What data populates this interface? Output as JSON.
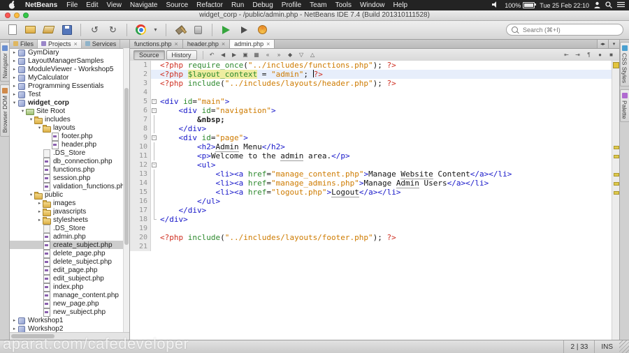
{
  "menubar": {
    "app_name": "NetBeans",
    "items": [
      "File",
      "Edit",
      "View",
      "Navigate",
      "Source",
      "Refactor",
      "Run",
      "Debug",
      "Profile",
      "Team",
      "Tools",
      "Window",
      "Help"
    ],
    "status": {
      "battery_percent": "100%",
      "clock": "Tue 25 Feb 22:10"
    }
  },
  "titlebar": {
    "title": "widget_corp - /public/admin.php - NetBeans IDE 7.4 (Build 201310111528)"
  },
  "toolbar": {
    "icons": [
      "new-file",
      "new-project",
      "open-project",
      "save-all",
      "undo",
      "redo",
      "browser-chrome",
      "browser-dropdown",
      "build-project",
      "clean-build",
      "run-project",
      "debug-project",
      "profile-project"
    ],
    "search_placeholder": "Search (⌘+I)"
  },
  "panel": {
    "tabs": [
      {
        "label": "Files",
        "active": false
      },
      {
        "label": "Projects",
        "active": true,
        "closable": true
      },
      {
        "label": "Services",
        "active": false
      }
    ],
    "side_tabs": [
      "Navigator",
      "Browser DOM"
    ],
    "tree": [
      {
        "l": "GymDiary",
        "d": 0,
        "t": "proj",
        "a": "r"
      },
      {
        "l": "LayoutManagerSamples",
        "d": 0,
        "t": "proj",
        "a": "r"
      },
      {
        "l": "ModuleViewer - Workshop5",
        "d": 0,
        "t": "proj",
        "a": "r"
      },
      {
        "l": "MyCalculator",
        "d": 0,
        "t": "proj",
        "a": "r"
      },
      {
        "l": "Programming Essentials",
        "d": 0,
        "t": "proj",
        "a": "r"
      },
      {
        "l": "Test",
        "d": 0,
        "t": "proj",
        "a": "r"
      },
      {
        "l": "widget_corp",
        "d": 0,
        "t": "proj",
        "a": "d",
        "b": true
      },
      {
        "l": "Site Root",
        "d": 1,
        "t": "root",
        "a": "d"
      },
      {
        "l": "includes",
        "d": 2,
        "t": "folder",
        "a": "d"
      },
      {
        "l": "layouts",
        "d": 3,
        "t": "folder",
        "a": "d"
      },
      {
        "l": "footer.php",
        "d": 4,
        "t": "php"
      },
      {
        "l": "header.php",
        "d": 4,
        "t": "php"
      },
      {
        "l": ".DS_Store",
        "d": 3,
        "t": "file"
      },
      {
        "l": "db_connection.php",
        "d": 3,
        "t": "php"
      },
      {
        "l": "functions.php",
        "d": 3,
        "t": "php"
      },
      {
        "l": "session.php",
        "d": 3,
        "t": "php"
      },
      {
        "l": "validation_functions.php",
        "d": 3,
        "t": "php"
      },
      {
        "l": "public",
        "d": 2,
        "t": "folder",
        "a": "d"
      },
      {
        "l": "images",
        "d": 3,
        "t": "folder",
        "a": "r"
      },
      {
        "l": "javascripts",
        "d": 3,
        "t": "folder",
        "a": "r"
      },
      {
        "l": "stylesheets",
        "d": 3,
        "t": "folder",
        "a": "r"
      },
      {
        "l": ".DS_Store",
        "d": 3,
        "t": "file"
      },
      {
        "l": "admin.php",
        "d": 3,
        "t": "php"
      },
      {
        "l": "create_subject.php",
        "d": 3,
        "t": "php",
        "sel": true
      },
      {
        "l": "delete_page.php",
        "d": 3,
        "t": "php"
      },
      {
        "l": "delete_subject.php",
        "d": 3,
        "t": "php"
      },
      {
        "l": "edit_page.php",
        "d": 3,
        "t": "php"
      },
      {
        "l": "edit_subject.php",
        "d": 3,
        "t": "php"
      },
      {
        "l": "index.php",
        "d": 3,
        "t": "php"
      },
      {
        "l": "manage_content.php",
        "d": 3,
        "t": "php"
      },
      {
        "l": "new_page.php",
        "d": 3,
        "t": "php"
      },
      {
        "l": "new_subject.php",
        "d": 3,
        "t": "php"
      },
      {
        "l": "Workshop1",
        "d": 0,
        "t": "proj",
        "a": "r"
      },
      {
        "l": "Workshop2",
        "d": 0,
        "t": "proj",
        "a": "r"
      }
    ]
  },
  "editor": {
    "tabs": [
      {
        "label": "functions.php",
        "active": false
      },
      {
        "label": "header.php",
        "active": false
      },
      {
        "label": "admin.php",
        "active": true
      }
    ],
    "views": [
      "Source",
      "History"
    ],
    "toolbar_icons_left": [
      {
        "name": "last-edit",
        "glyph": "↶"
      },
      {
        "name": "back",
        "glyph": "◀"
      },
      {
        "name": "forward",
        "glyph": "▶"
      },
      {
        "name": "find-selection",
        "glyph": "▣"
      },
      {
        "name": "highlight-occurrences",
        "glyph": "▦"
      },
      {
        "name": "previous-bookmark",
        "glyph": "«"
      },
      {
        "name": "next-bookmark",
        "glyph": "»"
      },
      {
        "name": "toggle-bookmark",
        "glyph": "◆"
      },
      {
        "name": "next-error",
        "glyph": "▽"
      },
      {
        "name": "previous-error",
        "glyph": "△"
      }
    ],
    "toolbar_icons_right": [
      {
        "name": "shift-left",
        "glyph": "⇤"
      },
      {
        "name": "shift-right",
        "glyph": "⇥"
      },
      {
        "name": "comment",
        "glyph": "¶"
      },
      {
        "name": "start-macro",
        "glyph": "●"
      },
      {
        "name": "stop-macro",
        "glyph": "■"
      }
    ],
    "side_tabs": [
      "CSS Styles",
      "Palette"
    ],
    "current_line": 2,
    "warning_lines": [
      10,
      11,
      13,
      14,
      15
    ],
    "fold": [
      "",
      "",
      "",
      "",
      "box",
      "box",
      "bar",
      "bar",
      "box",
      "bar",
      "bar",
      "box",
      "bar",
      "bar",
      "bar",
      "bar",
      "bar",
      "end",
      "",
      "",
      ""
    ],
    "lines": [
      [
        [
          "pt",
          "<?php "
        ],
        [
          "kw",
          "require_once"
        ],
        [
          "pl",
          "("
        ],
        [
          "st",
          "\"../includes/functions.php\""
        ],
        [
          "pl",
          "); "
        ],
        [
          "pt",
          "?>"
        ]
      ],
      [
        [
          "pt",
          "<?php "
        ],
        [
          "vr",
          "$layout_context"
        ],
        [
          "pl",
          " = "
        ],
        [
          "st",
          "\"admin\""
        ],
        [
          "pl",
          "; "
        ],
        [
          "caret",
          ""
        ],
        [
          "pt",
          "?>"
        ]
      ],
      [
        [
          "pt",
          "<?php "
        ],
        [
          "kw",
          "include"
        ],
        [
          "pl",
          "("
        ],
        [
          "st",
          "\"../includes/layouts/header.php\""
        ],
        [
          "pl",
          "); "
        ],
        [
          "pt",
          "?>"
        ]
      ],
      [],
      [
        [
          "tg",
          "<div"
        ],
        [
          "pl",
          " "
        ],
        [
          "at",
          "id"
        ],
        [
          "pl",
          "="
        ],
        [
          "st",
          "\"main\""
        ],
        [
          "tg",
          ">"
        ]
      ],
      [
        [
          "pl",
          "    "
        ],
        [
          "tg",
          "<div"
        ],
        [
          "pl",
          " "
        ],
        [
          "at",
          "id"
        ],
        [
          "pl",
          "="
        ],
        [
          "st",
          "\"navigation\""
        ],
        [
          "tg",
          ">"
        ]
      ],
      [
        [
          "pl",
          "        "
        ],
        [
          "en",
          "&nbsp;"
        ]
      ],
      [
        [
          "pl",
          "    "
        ],
        [
          "tg",
          "</div>"
        ]
      ],
      [
        [
          "pl",
          "    "
        ],
        [
          "tg",
          "<div"
        ],
        [
          "pl",
          " "
        ],
        [
          "at",
          "id"
        ],
        [
          "pl",
          "="
        ],
        [
          "st",
          "\"page\""
        ],
        [
          "tg",
          ">"
        ]
      ],
      [
        [
          "pl",
          "        "
        ],
        [
          "tg",
          "<h2>"
        ],
        [
          "pl mi",
          "Admin"
        ],
        [
          "pl",
          " Menu"
        ],
        [
          "tg",
          "</h2>"
        ]
      ],
      [
        [
          "pl",
          "        "
        ],
        [
          "tg",
          "<p>"
        ],
        [
          "pl",
          "Welcome to the "
        ],
        [
          "pl mi",
          "admin"
        ],
        [
          "pl",
          " area."
        ],
        [
          "tg",
          "</p>"
        ]
      ],
      [
        [
          "pl",
          "        "
        ],
        [
          "tg",
          "<ul>"
        ]
      ],
      [
        [
          "pl",
          "            "
        ],
        [
          "tg",
          "<li><a"
        ],
        [
          "pl",
          " "
        ],
        [
          "at",
          "href"
        ],
        [
          "pl",
          "="
        ],
        [
          "st",
          "\"manage_content.php\""
        ],
        [
          "tg",
          ">"
        ],
        [
          "pl",
          "Manage "
        ],
        [
          "pl mi",
          "Website"
        ],
        [
          "pl",
          " Content"
        ],
        [
          "tg",
          "</a></li>"
        ]
      ],
      [
        [
          "pl",
          "            "
        ],
        [
          "tg",
          "<li><a"
        ],
        [
          "pl",
          " "
        ],
        [
          "at",
          "href"
        ],
        [
          "pl",
          "="
        ],
        [
          "st",
          "\"manage_admins.php\""
        ],
        [
          "tg",
          ">"
        ],
        [
          "pl",
          "Manage "
        ],
        [
          "pl mi",
          "Admin"
        ],
        [
          "pl",
          " Users"
        ],
        [
          "tg",
          "</a></li>"
        ]
      ],
      [
        [
          "pl",
          "            "
        ],
        [
          "tg",
          "<li><a"
        ],
        [
          "pl",
          " "
        ],
        [
          "at",
          "href"
        ],
        [
          "pl",
          "="
        ],
        [
          "st",
          "\"logout.php\""
        ],
        [
          "tg",
          ">"
        ],
        [
          "pl mi",
          "Logout"
        ],
        [
          "tg",
          "</a></li>"
        ]
      ],
      [
        [
          "pl",
          "        "
        ],
        [
          "tg",
          "</ul>"
        ]
      ],
      [
        [
          "pl",
          "    "
        ],
        [
          "tg",
          "</div>"
        ]
      ],
      [
        [
          "tg",
          "</div>"
        ]
      ],
      [],
      [
        [
          "pt",
          "<?php "
        ],
        [
          "kw",
          "include"
        ],
        [
          "pl",
          "("
        ],
        [
          "st",
          "\"../includes/layouts/footer.php\""
        ],
        [
          "pl",
          "); "
        ],
        [
          "pt",
          "?>"
        ]
      ],
      []
    ]
  },
  "statusbar": {
    "caret": "2 | 33",
    "mode": "INS"
  },
  "watermark": "aparat.com/cafedeveloper"
}
